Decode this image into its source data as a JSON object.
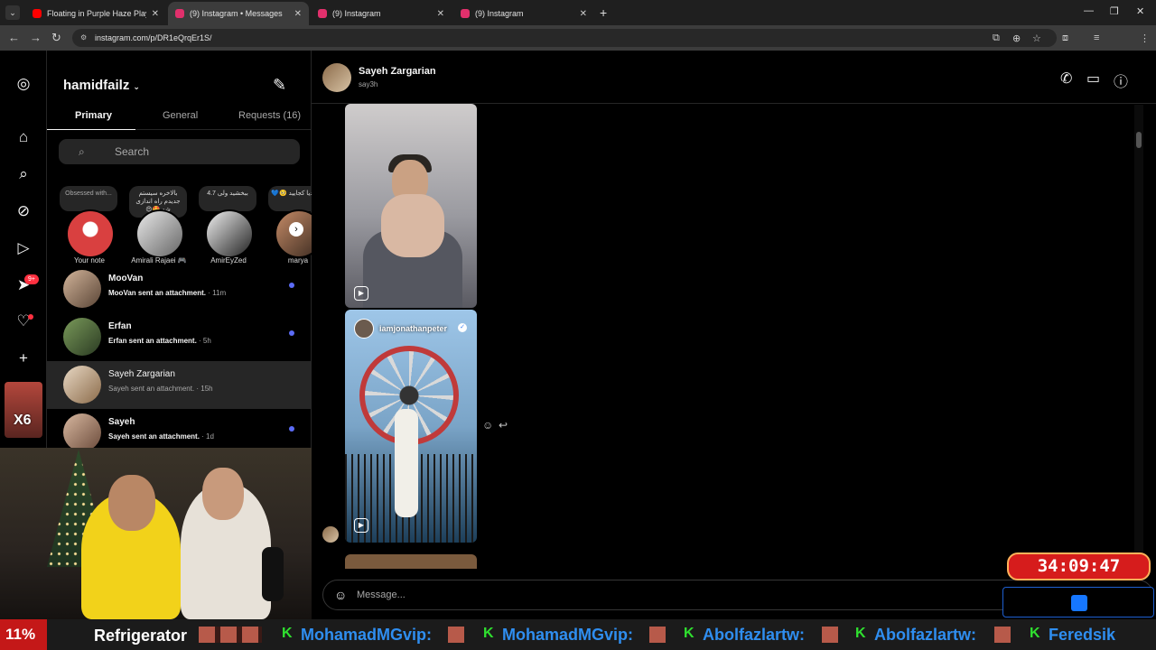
{
  "browser": {
    "tabs": [
      {
        "title": "Floating in Purple Haze Playlist",
        "color": "#ff0000"
      },
      {
        "title": "(9) Instagram • Messages",
        "color": "#e1306c"
      },
      {
        "title": "(9) Instagram",
        "color": "#e1306c"
      },
      {
        "title": "(9) Instagram",
        "color": "#e1306c"
      }
    ],
    "url": "instagram.com/p/DR1eQrqEr1S/",
    "profile_initial": "H"
  },
  "rail": {
    "badge": "9+"
  },
  "inbox": {
    "username": "hamidfailz",
    "tabs": [
      "Primary",
      "General",
      "Requests (16)"
    ],
    "search_placeholder": "Search",
    "notes": [
      {
        "text": "Obsessed with...",
        "name": "Your note"
      },
      {
        "text": "بالاخره سیستم جدیدم راه اندازی شد 🤩😍",
        "name": "Amirali Rajaei 🎮"
      },
      {
        "text": "ببخشید ولی 4.7",
        "name": "AmirEyZed"
      },
      {
        "text": "❄️یدیا کجایید 🥺💙",
        "name": "marya"
      }
    ],
    "threads": [
      {
        "name": "MooVan",
        "message": "MooVan sent an attachment.",
        "time": " · 11m"
      },
      {
        "name": "Erfan",
        "message": "Erfan sent an attachment.",
        "time": " · 5h"
      },
      {
        "name": "Sayeh Zargarian",
        "message": "Sayeh sent an attachment.",
        "time": " · 15h"
      },
      {
        "name": "Sayeh",
        "message": "Sayeh sent an attachment.",
        "time": " · 1d"
      }
    ]
  },
  "chat": {
    "name": "Sayeh Zargarian",
    "handle": "say3h",
    "shared_reel_user": "iamjonathanpeter",
    "composer_placeholder": "Message..."
  },
  "stream": {
    "timer": "34:09:47",
    "sticker_text": "X6",
    "ticker": {
      "percent": "11%",
      "title": "Refrigerator",
      "names": [
        "MohamadMGvip:",
        "MohamadMGvip:",
        "Abolfazlartw:",
        "Abolfazlartw:",
        "Feredsik"
      ]
    }
  }
}
